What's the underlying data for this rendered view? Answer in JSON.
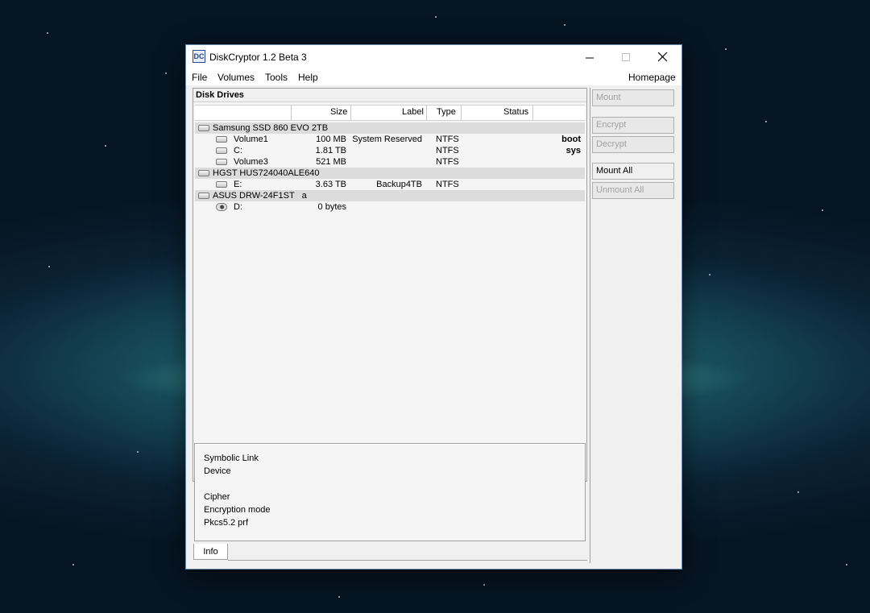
{
  "window": {
    "title": "DiskCryptor 1.2 Beta 3"
  },
  "menu": {
    "file": "File",
    "volumes": "Volumes",
    "tools": "Tools",
    "help": "Help",
    "homepage": "Homepage"
  },
  "panel": {
    "caption": "Disk Drives"
  },
  "columns": {
    "size": "Size",
    "label": "Label",
    "type": "Type",
    "status": "Status"
  },
  "drives": [
    {
      "kind": "disk",
      "name": "Samsung SSD 860 EVO 2TB"
    },
    {
      "kind": "volume",
      "name": "Volume1",
      "size": "100 MB",
      "label": "System Reserved",
      "type": "NTFS",
      "status": "boot"
    },
    {
      "kind": "volume",
      "name": "C:",
      "size": "1.81 TB",
      "label": "",
      "type": "NTFS",
      "status": "sys"
    },
    {
      "kind": "volume",
      "name": "Volume3",
      "size": "521 MB",
      "label": "",
      "type": "NTFS",
      "status": ""
    },
    {
      "kind": "disk",
      "name": "HGST HUS724040ALE640"
    },
    {
      "kind": "volume",
      "name": "E:",
      "size": "3.63 TB",
      "label": "Backup4TB",
      "type": "NTFS",
      "status": ""
    },
    {
      "kind": "disk",
      "name": "ASUS DRW-24F1ST   a"
    },
    {
      "kind": "cdrom",
      "name": "D:",
      "size": "0 bytes",
      "label": "",
      "type": "",
      "status": ""
    }
  ],
  "info": {
    "symbolic_link": "Symbolic Link",
    "device": "Device",
    "cipher": "Cipher",
    "encryption_mode": "Encryption mode",
    "prf": "Pkcs5.2 prf",
    "tab": "Info"
  },
  "buttons": {
    "mount": "Mount",
    "encrypt": "Encrypt",
    "decrypt": "Decrypt",
    "mount_all": "Mount All",
    "unmount_all": "Unmount All"
  }
}
